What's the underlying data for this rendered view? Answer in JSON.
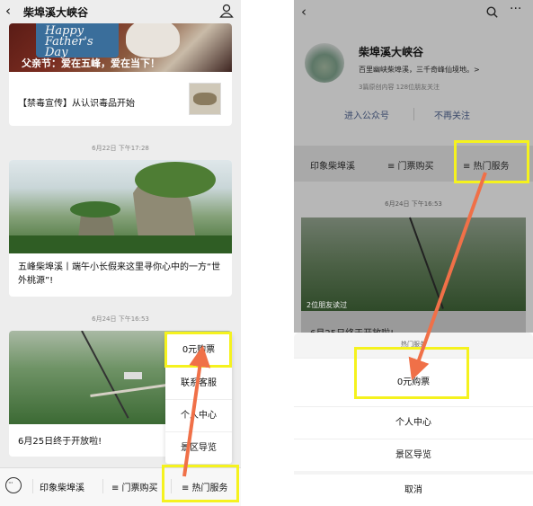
{
  "left": {
    "header": {
      "title": "柴埠溪大峡谷"
    },
    "article1": {
      "image_sign": "Happy Father's Day",
      "image_caption": "父亲节：爱在五峰，爱在当下！",
      "text": "【禁毒宣传】从认识毒品开始"
    },
    "timestamp1": "6月22日 下午17:28",
    "article2": {
      "text": "五峰柴埠溪丨端午小长假来这里寻你心中的一方“世外桃源”!"
    },
    "timestamp2": "6月24日 下午16:53",
    "article3": {
      "text": "6月25日终于开放啦!"
    },
    "menu": [
      "0元购票",
      "联系客服",
      "个人中心",
      "景区导览"
    ],
    "bottom_tabs": [
      "印象柴埠溪",
      "≡ 门票购买",
      "≡ 热门服务"
    ]
  },
  "right": {
    "profile": {
      "name": "柴埠溪大峡谷",
      "desc": "百里幽峡柴埠溪，三千奇峰仙境地。>",
      "stats": "3篇原创内容    128位朋友关注"
    },
    "buttons": [
      "进入公众号",
      "不再关注"
    ],
    "tabs": [
      "印象柴埠溪",
      "≡ 门票购买",
      "≡ 热门服务"
    ],
    "timestamp": "6月24日 下午16:53",
    "card": {
      "friends_read": "2位朋友读过",
      "text": "6月25日终于开放啦!"
    },
    "sheet": {
      "title": "热门服务",
      "items": [
        "0元购票",
        "个人中心",
        "景区导览"
      ],
      "cancel": "取消"
    }
  },
  "colors": {
    "highlight": "#f5f21e",
    "arrow": "#f07048"
  }
}
